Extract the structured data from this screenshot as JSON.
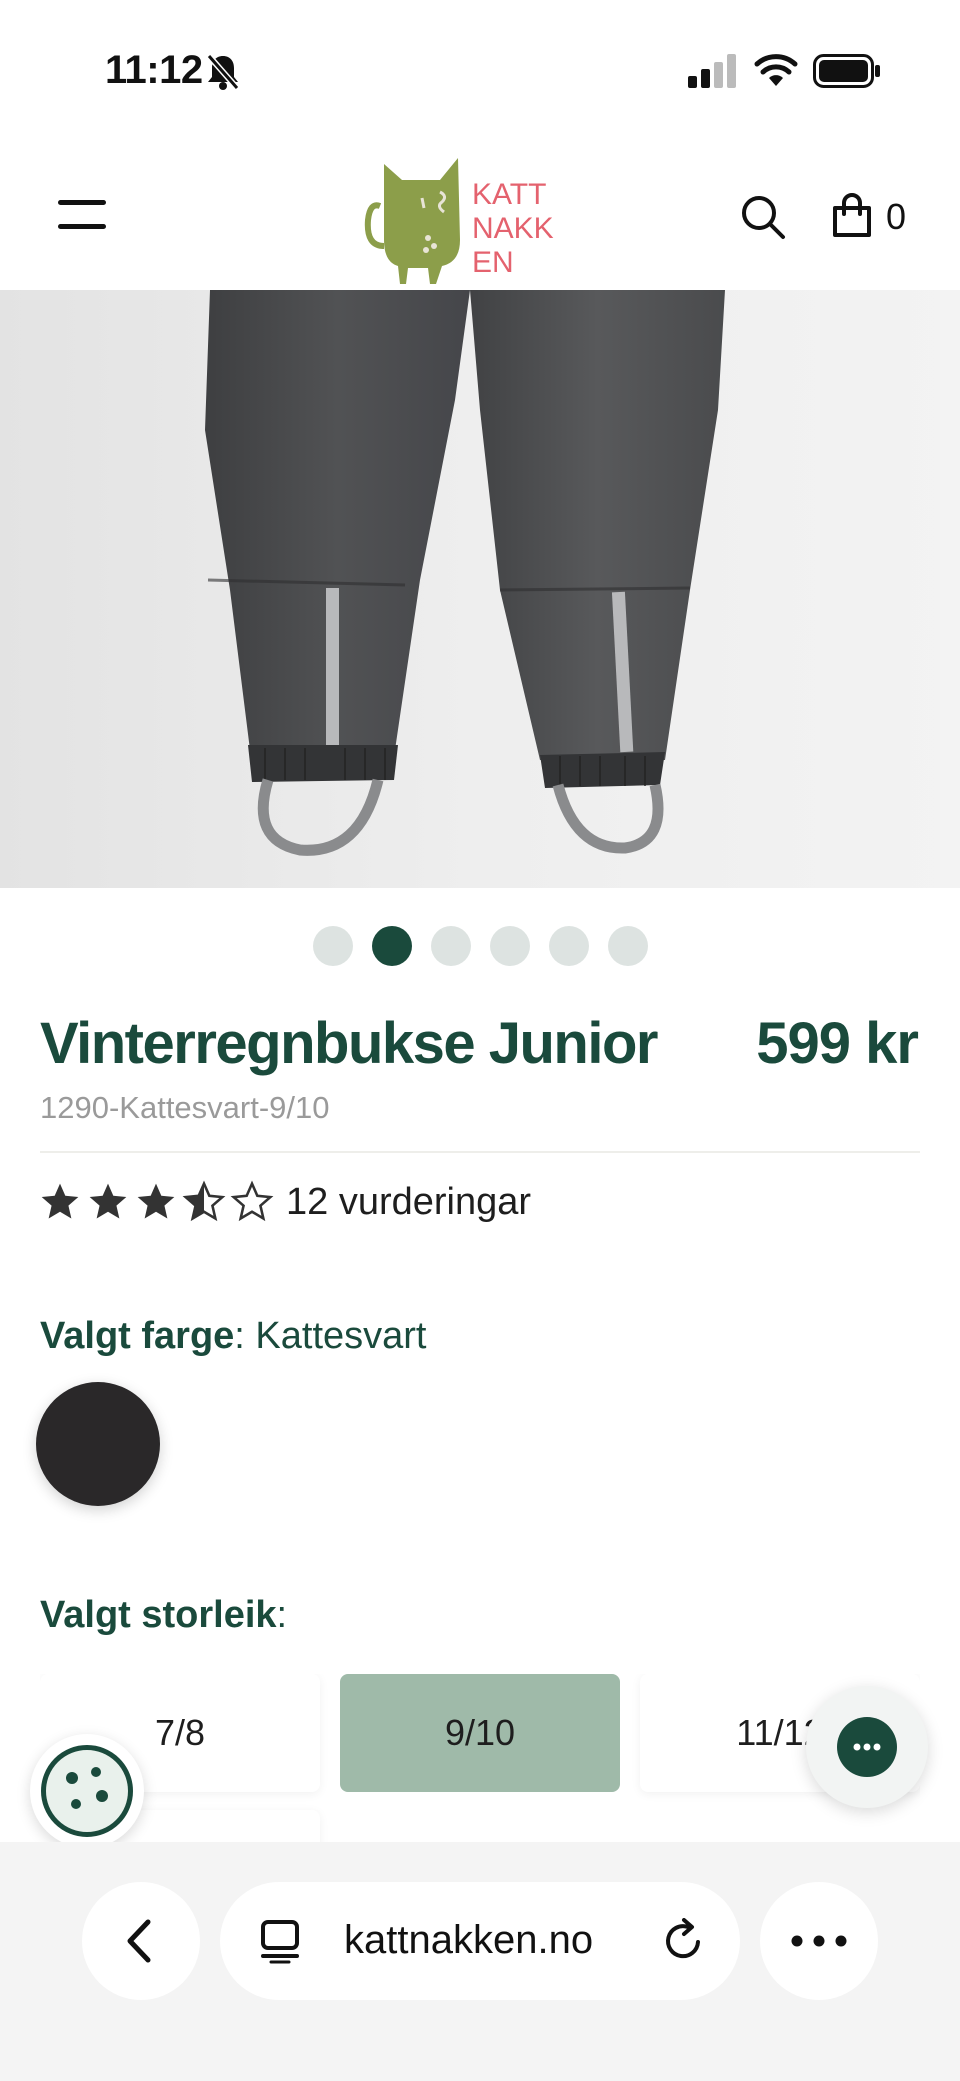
{
  "status_bar": {
    "time": "11:12"
  },
  "header": {
    "logo_text": [
      "KATT",
      "NAKK",
      "EN"
    ],
    "cart_count": "0"
  },
  "carousel": {
    "count": 6,
    "active_index": 1
  },
  "product": {
    "title": "Vinterregnbukse Junior",
    "price": "599 kr",
    "sku": "1290-Kattesvart-9/10",
    "rating_value": 3.5,
    "rating_max": 5,
    "rating_text": "12 vurderingar"
  },
  "color": {
    "label": "Valgt farge",
    "value": ": Kattesvart",
    "swatch_hex": "#2a2829"
  },
  "size": {
    "label": "Valgt storleik",
    "suffix": ":",
    "options": [
      "7/8",
      "9/10",
      "11/12"
    ],
    "selected": "9/10"
  },
  "browser": {
    "url": "kattnakken.no"
  },
  "colors": {
    "brand_green": "#1a4a3c",
    "selected_size": "#9fbaa9",
    "logo_green": "#8c9e4a",
    "logo_pink": "#e4626e"
  }
}
